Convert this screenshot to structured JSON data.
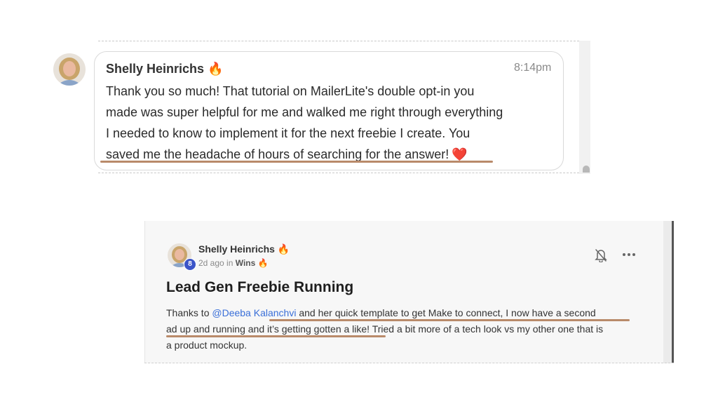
{
  "chat": {
    "author": "Shelly Heinrichs",
    "author_emoji": "🔥",
    "time": "8:14pm",
    "lines": [
      "Thank you so much! That tutorial on MailerLite's double opt-in you",
      "made was super helpful for me and walked me right through everything",
      "I needed to know to implement it for the next freebie I create. You",
      "saved me the headache of hours of searching for the answer!"
    ],
    "end_emoji": "❤️"
  },
  "post": {
    "author": "Shelly Heinrichs",
    "author_emoji": "🔥",
    "level": "8",
    "time_ago": "2d ago",
    "in_word": "in",
    "category": "Wins",
    "category_emoji": "🔥",
    "title": "Lead Gen Freebie Running",
    "body_prefix": "Thanks to",
    "mention": "@Deeba Kalanchvi",
    "body_line1_rest": " and her quick template to get Make to connect, I now have a second",
    "body_line2": "ad up and running and it’s getting gotten a like! Tried a bit more of a tech look vs my other one that is",
    "body_line3": "a product mockup.",
    "icons": [
      "bell-off-icon",
      "more-horizontal-icon"
    ]
  },
  "colors": {
    "underline": "#b98a6a",
    "mention": "#3a6fd8",
    "badge": "#3b55c8"
  }
}
